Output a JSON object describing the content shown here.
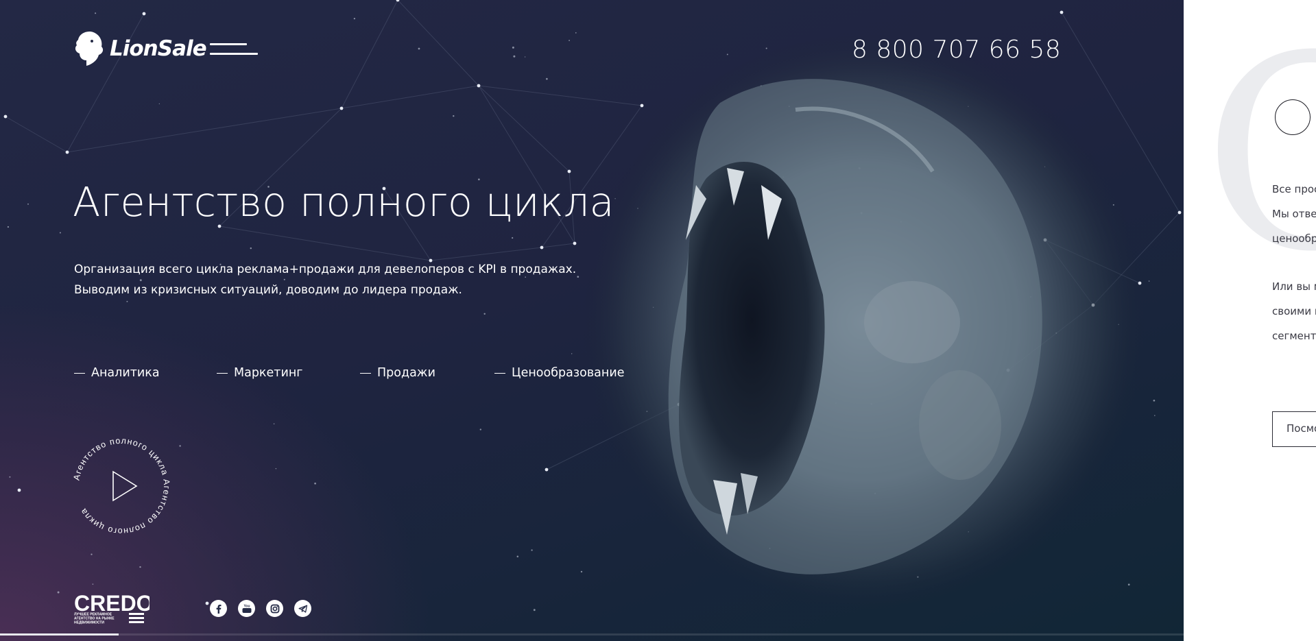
{
  "header": {
    "logo_text": "LionSale",
    "phone": "8 800 707 66 58"
  },
  "hero": {
    "title": "Агентство полного цикла",
    "description": [
      "Организация всего цикла реклама+продажи для девелоперов с KPI в продажах.",
      "Выводим из кризисных ситуаций, доводим до лидера продаж."
    ],
    "services": [
      "Аналитика",
      "Маркетинг",
      "Продажи",
      "Ценообразование"
    ],
    "video_badge_text": "Агентство полного цикла ",
    "progress": 0.1
  },
  "footer": {
    "award_logo_text": "CREDO",
    "award_logo_caption": [
      "ЛУЧШЕЕ РЕКЛАМНОЕ",
      "АГЕНТСТВО НА РЫНКЕ",
      "НЕДВИЖИМОСТИ"
    ],
    "socials": [
      "facebook-icon",
      "youtube-icon",
      "instagram-icon",
      "telegram-icon"
    ]
  },
  "panel": {
    "big_letter": "C",
    "paragraph1": [
      "Все прос",
      "Мы отвеч",
      "ценообр"
    ],
    "paragraph2": [
      "Или вы м",
      "своими п",
      "сегменте"
    ],
    "button_label": "Посмо"
  },
  "colors": {
    "hero_dark": "#1f2440",
    "hero_purple": "#4a2f55",
    "hero_teal": "#112636",
    "panel_bg": "#ffffff",
    "text_light": "#ffffff",
    "text_dark": "#3a3a44"
  }
}
